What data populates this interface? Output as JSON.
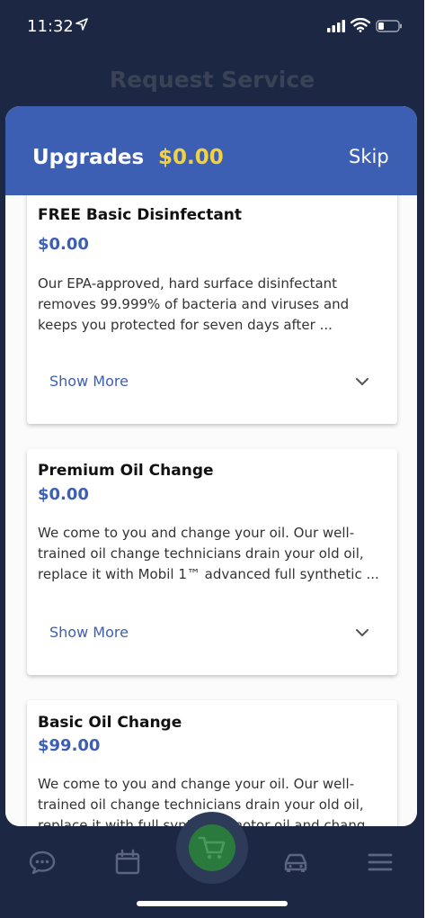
{
  "status_bar": {
    "time": "11:32"
  },
  "background": {
    "screen_title": "Request Service"
  },
  "sheet": {
    "title": "Upgrades",
    "total": "$0.00",
    "skip_label": "Skip"
  },
  "cards": [
    {
      "name": "FREE Basic Disinfectant",
      "price": "$0.00",
      "desc": [
        "Our EPA-approved, hard surface disinfectant",
        "removes 99.999% of bacteria and viruses and",
        "keeps you protected for seven days after ..."
      ],
      "more_label": "Show More"
    },
    {
      "name": "Premium Oil Change",
      "price": "$0.00",
      "desc": [
        "We come to you and change your oil. Our well-",
        "trained oil change technicians drain your old oil,",
        "replace it with Mobil 1™ advanced full synthetic ..."
      ],
      "more_label": "Show More"
    },
    {
      "name": "Basic Oil Change",
      "price": "$99.00",
      "desc": [
        "We come to you and change your oil. Our well-",
        "trained oil change technicians drain your old oil,",
        "replace it with full synthetic motor oil and chang"
      ]
    }
  ],
  "tabbar": {
    "icons": [
      "chat-icon",
      "calendar-icon",
      "cart-icon",
      "car-icon",
      "menu-icon"
    ]
  },
  "colors": {
    "navy": "#1c2744",
    "header_blue": "#3d5fb3",
    "amount_yellow": "#f2d240",
    "cart_green": "#2b7a3d"
  }
}
